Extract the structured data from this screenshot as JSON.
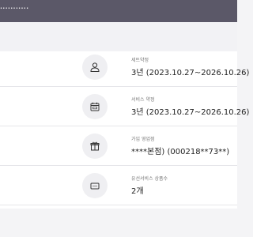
{
  "header": {
    "masked_text": "•••••••••••"
  },
  "rows": [
    {
      "icon": "person-icon",
      "label": "세트약정",
      "value": "3년 (2023.10.27~2026.10.26)"
    },
    {
      "icon": "calendar-icon",
      "label": "서비스 약정",
      "value": "3년 (2023.10.27~2026.10.26)"
    },
    {
      "icon": "gift-icon",
      "label": "가입 영업점",
      "value": "****본점) (000218**73**)"
    },
    {
      "icon": "router-icon",
      "label": "유선서비스 상품수",
      "value": "2개"
    }
  ],
  "colors": {
    "header_bg": "#5b5868",
    "icon_circle": "#efeff2",
    "divider": "#e6e6ea"
  }
}
